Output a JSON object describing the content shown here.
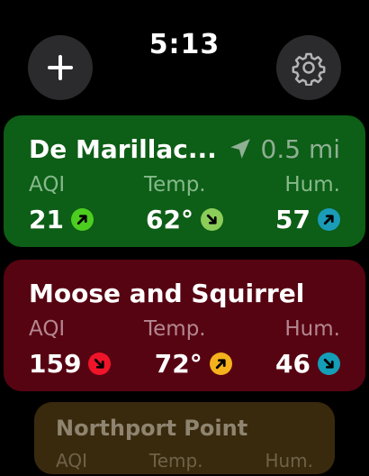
{
  "status_bar": {
    "time": "5:13"
  },
  "toolbar": {
    "add_icon": "plus-icon",
    "settings_icon": "gear-icon"
  },
  "locations": [
    {
      "name": "De Marillac...",
      "distance": "0.5 mi",
      "distance_icon": "location-arrow-icon",
      "color": "#0d5e16",
      "labels": {
        "aqi": "AQI",
        "temp": "Temp.",
        "hum": "Hum."
      },
      "aqi": {
        "value": "21",
        "trend": "up",
        "color": "#4ccd1f"
      },
      "temp": {
        "value": "62°",
        "trend": "down",
        "color": "#8ccd5a"
      },
      "hum": {
        "value": "57",
        "trend": "up",
        "color": "#1a9bb8"
      }
    },
    {
      "name": "Moose and Squirrel",
      "color": "#570412",
      "labels": {
        "aqi": "AQI",
        "temp": "Temp.",
        "hum": "Hum."
      },
      "aqi": {
        "value": "159",
        "trend": "down",
        "color": "#f0142a"
      },
      "temp": {
        "value": "72°",
        "trend": "up",
        "color": "#f5b21d"
      },
      "hum": {
        "value": "46",
        "trend": "down",
        "color": "#149eb7"
      }
    },
    {
      "name": "Northport Point",
      "color": "#3a2a0d",
      "labels": {
        "aqi": "AQI",
        "temp": "Temp.",
        "hum": "Hum."
      }
    }
  ]
}
